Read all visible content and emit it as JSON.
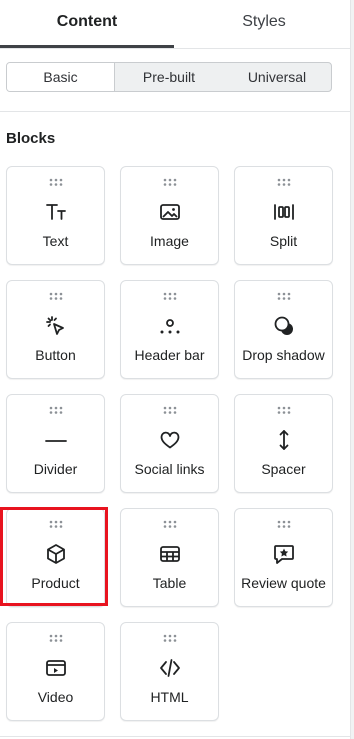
{
  "tabs": {
    "content": "Content",
    "styles": "Styles"
  },
  "segments": {
    "basic": "Basic",
    "prebuilt": "Pre-built",
    "universal": "Universal"
  },
  "section": {
    "title": "Blocks"
  },
  "blocks": [
    {
      "label": "Text",
      "icon": "text-icon"
    },
    {
      "label": "Image",
      "icon": "image-icon"
    },
    {
      "label": "Split",
      "icon": "split-icon"
    },
    {
      "label": "Button",
      "icon": "button-icon"
    },
    {
      "label": "Header bar",
      "icon": "header-bar-icon"
    },
    {
      "label": "Drop shadow",
      "icon": "drop-shadow-icon"
    },
    {
      "label": "Divider",
      "icon": "divider-icon"
    },
    {
      "label": "Social links",
      "icon": "heart-icon"
    },
    {
      "label": "Spacer",
      "icon": "spacer-icon"
    },
    {
      "label": "Product",
      "icon": "product-icon"
    },
    {
      "label": "Table",
      "icon": "table-icon"
    },
    {
      "label": "Review quote",
      "icon": "review-quote-icon"
    },
    {
      "label": "Video",
      "icon": "video-icon"
    },
    {
      "label": "HTML",
      "icon": "code-icon"
    }
  ],
  "colors": {
    "highlight": "#e8131f",
    "active_tab_underline": "#3f4246"
  }
}
